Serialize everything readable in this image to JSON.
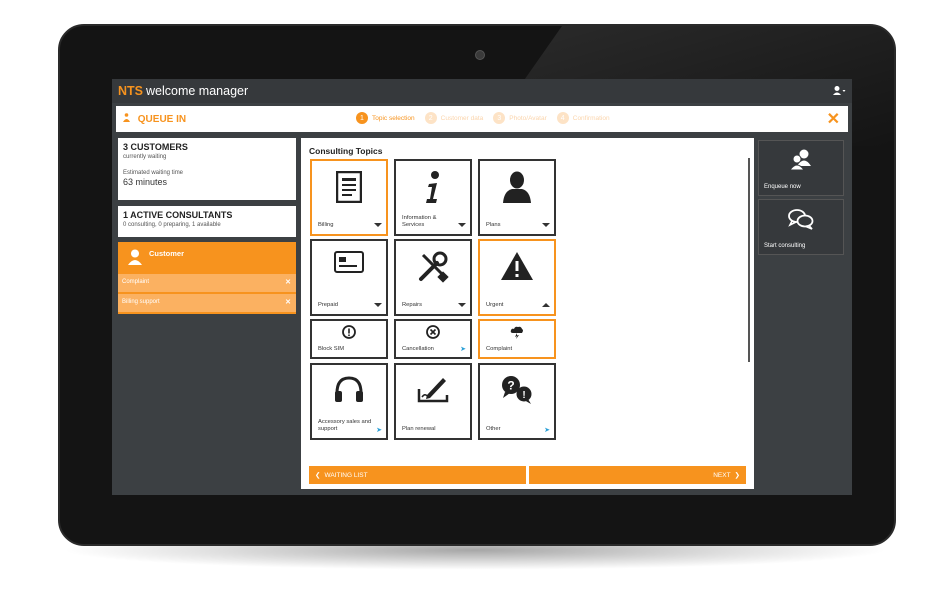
{
  "app": {
    "brand_prefix": "NTS",
    "brand_name": "welcome manager",
    "user_menu_icon": "user-menu-icon"
  },
  "queue": {
    "title": "QUEUE IN",
    "steps": [
      {
        "num": "1",
        "label": "Topic selection",
        "active": true
      },
      {
        "num": "2",
        "label": "Customer data",
        "active": false
      },
      {
        "num": "3",
        "label": "Photo/Avatar",
        "active": false
      },
      {
        "num": "4",
        "label": "Confirmation",
        "active": false
      }
    ],
    "close_icon": "close-icon"
  },
  "waiting": {
    "count_label": "3 CUSTOMERS",
    "subtitle": "currently waiting",
    "est_label": "Estimated waiting time",
    "est_value": "63 minutes"
  },
  "consultants": {
    "count_label": "1 ACTIVE CONSULTANTS",
    "detail": "0 consulting, 0 preparing, 1 available"
  },
  "customer": {
    "name": "Customer",
    "topics": [
      "Complaint",
      "Billing support"
    ],
    "remove_symbol": "✕"
  },
  "main": {
    "title": "Consulting Topics",
    "tiles": [
      {
        "label": "Billing",
        "icon": "document-icon",
        "selected": true,
        "indicator": "expand"
      },
      {
        "label": "Information & Services",
        "icon": "info-icon",
        "selected": false,
        "indicator": "expand"
      },
      {
        "label": "Plans",
        "icon": "person-icon",
        "selected": false,
        "indicator": "expand"
      },
      {
        "label": "Prepaid",
        "icon": "card-icon",
        "selected": false,
        "indicator": "expand"
      },
      {
        "label": "Repairs",
        "icon": "tools-icon",
        "selected": false,
        "indicator": "expand"
      },
      {
        "label": "Urgent",
        "icon": "warning-icon",
        "selected": true,
        "indicator": "collapse"
      },
      {
        "label": "Block SIM",
        "icon": "alert-circle-icon",
        "selected": false,
        "indicator": "none"
      },
      {
        "label": "Cancellation",
        "icon": "cancel-circle-icon",
        "selected": false,
        "indicator": "send"
      },
      {
        "label": "Complaint",
        "icon": "storm-cloud-icon",
        "selected": true,
        "indicator": "none"
      },
      {
        "label": "Accessory sales and support",
        "icon": "headphones-icon",
        "selected": false,
        "indicator": "send"
      },
      {
        "label": "Plan renewal",
        "icon": "pen-sign-icon",
        "selected": false,
        "indicator": "none"
      },
      {
        "label": "Other",
        "icon": "question-bubble-icon",
        "selected": false,
        "indicator": "send"
      }
    ],
    "waiting_list_label": "WAITING LIST",
    "next_label": "NEXT",
    "prev_arrow": "❮",
    "next_arrow": "❯"
  },
  "actions": {
    "enqueue_label": "Enqueue now",
    "enqueue_icon": "people-icon",
    "consult_label": "Start consulting",
    "consult_icon": "chat-bubbles-icon"
  },
  "colors": {
    "accent": "#f7931e",
    "accent_light": "#fbb161",
    "dark": "#36393c",
    "screen_bg": "#3c4043",
    "send_blue": "#2a9fd6"
  }
}
